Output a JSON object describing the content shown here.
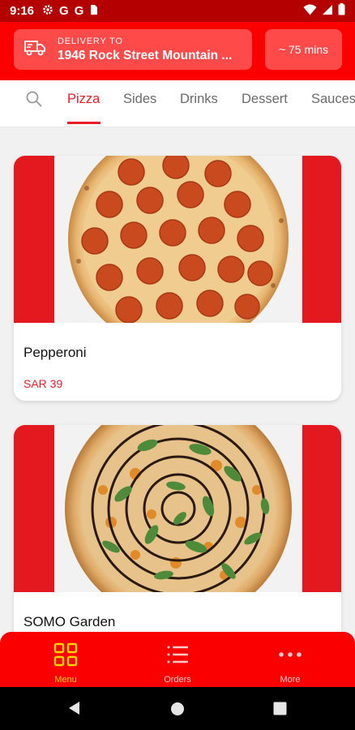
{
  "status_bar": {
    "time": "9:16",
    "notification_icons": [
      "settings-icon",
      "google-icon",
      "google-icon",
      "clipboard-icon"
    ],
    "google_letter": "G",
    "system_icons": [
      "wifi-icon",
      "signal-icon",
      "battery-icon"
    ]
  },
  "header": {
    "delivery_label": "DELIVERY TO",
    "delivery_address": "1946 Rock Street Mountain ...",
    "eta": "~ 75 mins",
    "icon": "delivery-truck-icon"
  },
  "tabs": {
    "items": [
      "Pizza",
      "Sides",
      "Drinks",
      "Dessert",
      "Sauces"
    ],
    "active": "Pizza"
  },
  "products": [
    {
      "name": "Pepperoni",
      "price": "SAR 39"
    },
    {
      "name": "SOMO Garden",
      "price": ""
    }
  ],
  "bottom_nav": {
    "items": [
      {
        "label": "Menu",
        "icon": "grid-icon"
      },
      {
        "label": "Orders",
        "icon": "list-icon"
      },
      {
        "label": "More",
        "icon": "more-dots-icon"
      }
    ],
    "active": "Menu"
  },
  "colors": {
    "brand_red": "#fb0000",
    "status_bar": "#b50000",
    "accent_text": "#ea1c24",
    "active_nav": "#ffd400"
  }
}
